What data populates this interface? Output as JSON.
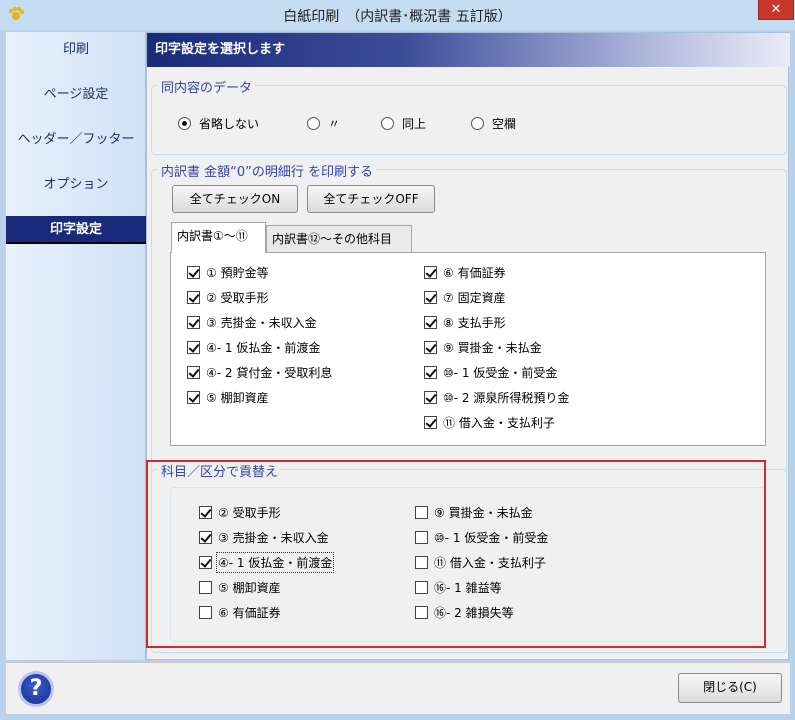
{
  "window": {
    "title": "白紙印刷　（内訳書･概況書 五訂版）",
    "close_glyph": "✕"
  },
  "sidebar": {
    "items": [
      "印刷",
      "ページ設定",
      "ヘッダー／フッター",
      "オプション",
      "印字設定"
    ],
    "active_index": 4
  },
  "header": {
    "title": "印字設定を選択します"
  },
  "same_content": {
    "label": "同内容のデータ",
    "options": [
      "省略しない",
      "〃",
      "同上",
      "空欄"
    ],
    "selected": 0
  },
  "zero_amount": {
    "label": "内訳書  金額“0”の明細行 を印刷する",
    "check_all_on": "全てチェックON",
    "check_all_off": "全てチェックOFF",
    "tabs": [
      "内訳書①～⑪",
      "内訳書⑫～その他科目"
    ],
    "active_tab": 0,
    "left_items": [
      {
        "label": "① 預貯金等",
        "checked": true
      },
      {
        "label": "② 受取手形",
        "checked": true
      },
      {
        "label": "③ 売掛金・未収入金",
        "checked": true
      },
      {
        "label": "④- 1  仮払金・前渡金",
        "checked": true
      },
      {
        "label": "④- 2  貸付金・受取利息",
        "checked": true
      },
      {
        "label": "⑤ 棚卸資産",
        "checked": true
      }
    ],
    "right_items": [
      {
        "label": "⑥ 有価証券",
        "checked": true
      },
      {
        "label": "⑦ 固定資産",
        "checked": true
      },
      {
        "label": "⑧ 支払手形",
        "checked": true
      },
      {
        "label": "⑨ 買掛金・未払金",
        "checked": true
      },
      {
        "label": "⑩- 1  仮受金・前受金",
        "checked": true
      },
      {
        "label": "⑩- 2  源泉所得税預り金",
        "checked": true
      },
      {
        "label": "⑪ 借入金・支払利子",
        "checked": true
      }
    ]
  },
  "reassign": {
    "label": "科目／区分で貢替え",
    "left_items": [
      {
        "label": "② 受取手形",
        "checked": true
      },
      {
        "label": "③ 売掛金・未収入金",
        "checked": true
      },
      {
        "label": "④- 1  仮払金・前渡金",
        "checked": true
      },
      {
        "label": "⑤ 棚卸資産",
        "checked": false
      },
      {
        "label": "⑥ 有価証券",
        "checked": false
      }
    ],
    "right_items": [
      {
        "label": "⑨ 買掛金・未払金",
        "checked": false
      },
      {
        "label": "⑩- 1  仮受金・前受金",
        "checked": false
      },
      {
        "label": "⑪ 借入金・支払利子",
        "checked": false
      },
      {
        "label": "⑯- 1  雑益等",
        "checked": false
      },
      {
        "label": "⑯- 2  雑損失等",
        "checked": false
      }
    ]
  },
  "footer": {
    "help_glyph": "?",
    "close_label": "閉じる(C)"
  },
  "colors": {
    "accent": "#1a2a7a",
    "highlight": "#d32b2b",
    "group_label": "#3344aa"
  }
}
